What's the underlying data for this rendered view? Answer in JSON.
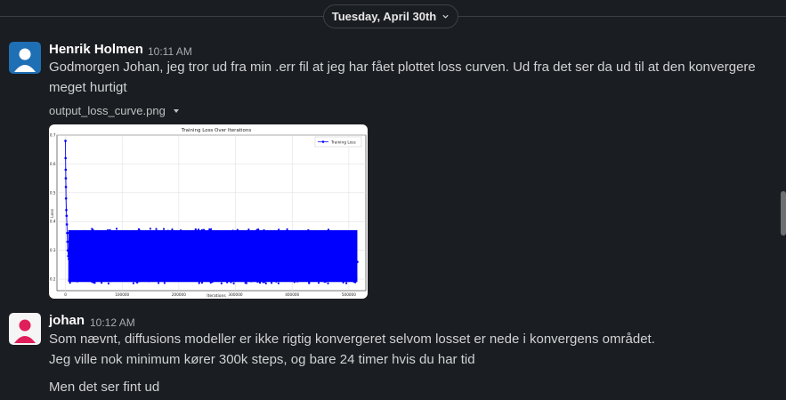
{
  "date_divider": {
    "label": "Tuesday, April 30th"
  },
  "messages": [
    {
      "author": "Henrik Holmen",
      "time": "10:11 AM",
      "lines": [
        "Godmorgen Johan, jeg tror ud fra min .err fil at jeg har fået plottet loss curven.  Ud fra det ser da ud til at den konvergere",
        "meget hurtigt"
      ],
      "attachment": {
        "filename": "output_loss_curve.png"
      }
    },
    {
      "author": "johan",
      "time": "10:12 AM",
      "lines": [
        "Som nævnt, diffusions modeller er ikke rigtig konvergeret selvom losset er nede i konvergens området.",
        "Jeg ville nok minimum kører 300k steps, og bare 24 timer hvis du har tid",
        "Men det ser fint ud"
      ]
    }
  ],
  "chart_data": {
    "type": "line",
    "title": "Training Loss Over Iterations",
    "xlabel": "Iterations",
    "ylabel": "Loss",
    "legend": "Training Loss",
    "legend_position": "top-right",
    "grid": true,
    "xlim": [
      -15000,
      530000
    ],
    "ylim": [
      0.16,
      0.7
    ],
    "x_ticks": [
      "0",
      "100000",
      "200000",
      "300000",
      "400000",
      "500000"
    ],
    "y_ticks": [
      "0.2",
      "0.3",
      "0.4",
      "0.5",
      "0.6",
      "0.7"
    ],
    "series": [
      {
        "name": "Training Loss",
        "color": "#0000ff",
        "x": [
          0,
          200,
          400,
          600,
          800,
          1000,
          1500,
          2000,
          2500,
          3000,
          3500,
          4000,
          5000,
          6000,
          8000,
          10000,
          15000,
          20000,
          50000,
          100000,
          150000,
          200000,
          250000,
          300000,
          350000,
          400000,
          450000,
          500000,
          515000
        ],
        "y": [
          0.68,
          0.62,
          0.58,
          0.55,
          0.52,
          0.48,
          0.44,
          0.42,
          0.39,
          0.36,
          0.33,
          0.3,
          0.28,
          0.27,
          0.26,
          0.26,
          0.27,
          0.26,
          0.27,
          0.26,
          0.27,
          0.26,
          0.26,
          0.26,
          0.27,
          0.26,
          0.26,
          0.27,
          0.26
        ],
        "noise_band": [
          0.19,
          0.37
        ]
      }
    ]
  }
}
